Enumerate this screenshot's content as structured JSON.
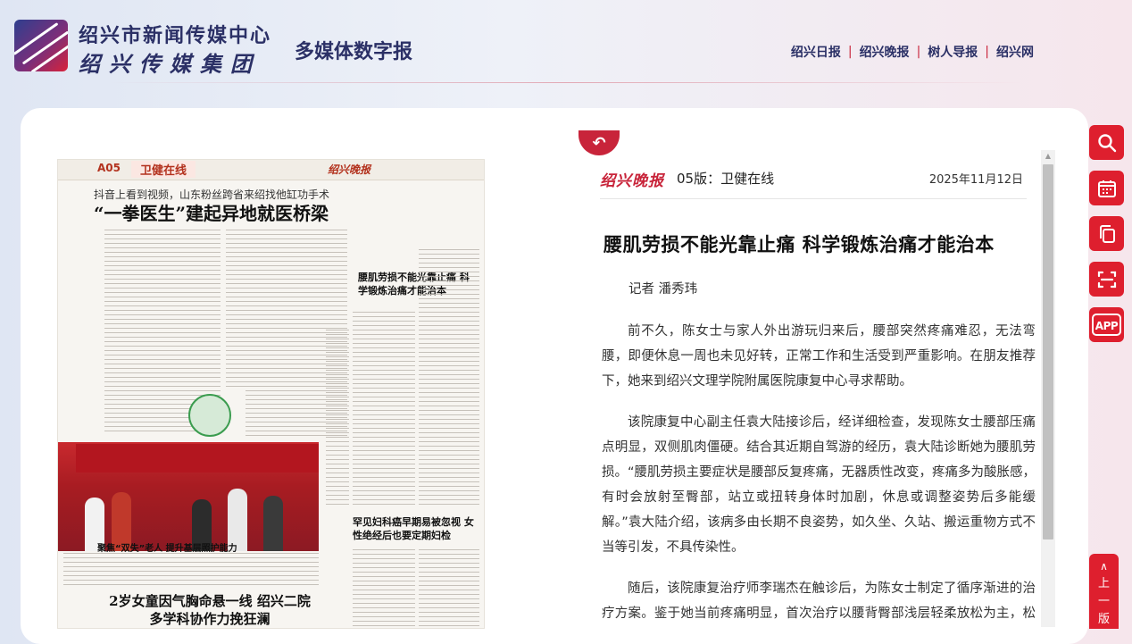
{
  "header": {
    "org_name_1": "绍兴市新闻传媒中心",
    "org_name_2": "绍兴传媒集团",
    "product_name": "多媒体数字报",
    "nav": [
      "绍兴日报",
      "绍兴晚报",
      "树人导报",
      "绍兴网"
    ],
    "nav_separator": "|"
  },
  "paper_page": {
    "edition_no": "A05",
    "edition_name": "卫健在线",
    "masthead": "绍兴晚报",
    "kicker": "抖音上看到视频，山东粉丝跨省来绍找他缸功手术",
    "headline": "“一拳医生”建起异地就医桥梁",
    "side_headline": "腰肌劳损不能光靠止痛 科学锻炼治痛才能治本",
    "photo_caption": "聚焦“双失”老人  提升基层照护能力",
    "side_headline_2": "罕见妇科癌早期易被忽视 女性绝经后也要定期妇检",
    "bottom_headline": "2岁女童因气胸命悬一线 绍兴二院多学科协作力挽狂澜"
  },
  "article": {
    "masthead": "绍兴晚报",
    "edition_label": "05版：卫健在线",
    "date": "2025年11月12日",
    "title": "腰肌劳损不能光靠止痛 科学锻炼治痛才能治本",
    "byline": "记者 潘秀玮",
    "paragraphs": [
      "前不久，陈女士与家人外出游玩归来后，腰部突然疼痛难忍，无法弯腰，即便休息一周也未见好转，正常工作和生活受到严重影响。在朋友推荐下，她来到绍兴文理学院附属医院康复中心寻求帮助。",
      "该院康复中心副主任袁大陆接诊后，经详细检查，发现陈女士腰部压痛点明显，双侧肌肉僵硬。结合其近期自驾游的经历，袁大陆诊断她为腰肌劳损。“腰肌劳损主要症状是腰部反复疼痛，无器质性改变，疼痛多为酸胀感，有时会放射至臀部，站立或扭转身体时加剧，休息或调整姿势后多能缓解。”袁大陆介绍，该病多由长期不良姿势，如久坐、久站、搬运重物方式不当等引发，不具传染性。",
      "随后，该院康复治疗师李瑞杰在触诊后，为陈女士制定了循序渐进的治疗方案。鉴于她当前疼痛明显，首次治疗以腰背臀部浅层轻柔放松为主，松解局部筋膜，促进新陈代谢和炎症消散，后续治疗着重"
    ]
  },
  "toolbar": {
    "icons": [
      "search-icon",
      "calendar-icon",
      "copy-icon",
      "scan-icon",
      "app-icon"
    ],
    "app_label": "APP",
    "back_to_top_label": "上一版",
    "accent_color": "#de1f2e"
  }
}
